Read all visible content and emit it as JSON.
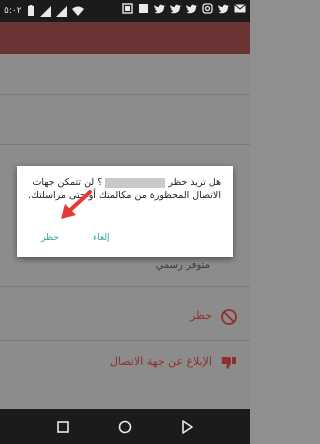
{
  "status_bar": {
    "time": "٥:٠٢",
    "icons": [
      "battery-icon",
      "signal-icon",
      "sim-signal-icon",
      "wifi-icon",
      "screenshot-icon",
      "notification-square-icon",
      "twitter-icon",
      "twitter-icon",
      "twitter-icon",
      "instagram-icon",
      "twitter-icon",
      "mail-icon"
    ]
  },
  "dialog": {
    "message_prefix": "هل تريد حظر",
    "message_suffix": "؟ لن تتمكن جهات الاتصال المحظورة من مكالمتك أو حتى مراسلتك.",
    "block_label": "حظر",
    "cancel_label": "إلغاء"
  },
  "background": {
    "partial_text": "متوفر رسمي"
  },
  "menu": {
    "block_label": "حظر",
    "report_label": "الإبلاغ عن جهة الاتصال"
  },
  "colors": {
    "accent": "#2aa79b",
    "toolbar": "#6a3334",
    "menu_red": "#8f2e2e",
    "arrow": "#e53935"
  },
  "nav": {
    "icons": [
      "back-icon",
      "home-icon",
      "recents-icon"
    ]
  }
}
